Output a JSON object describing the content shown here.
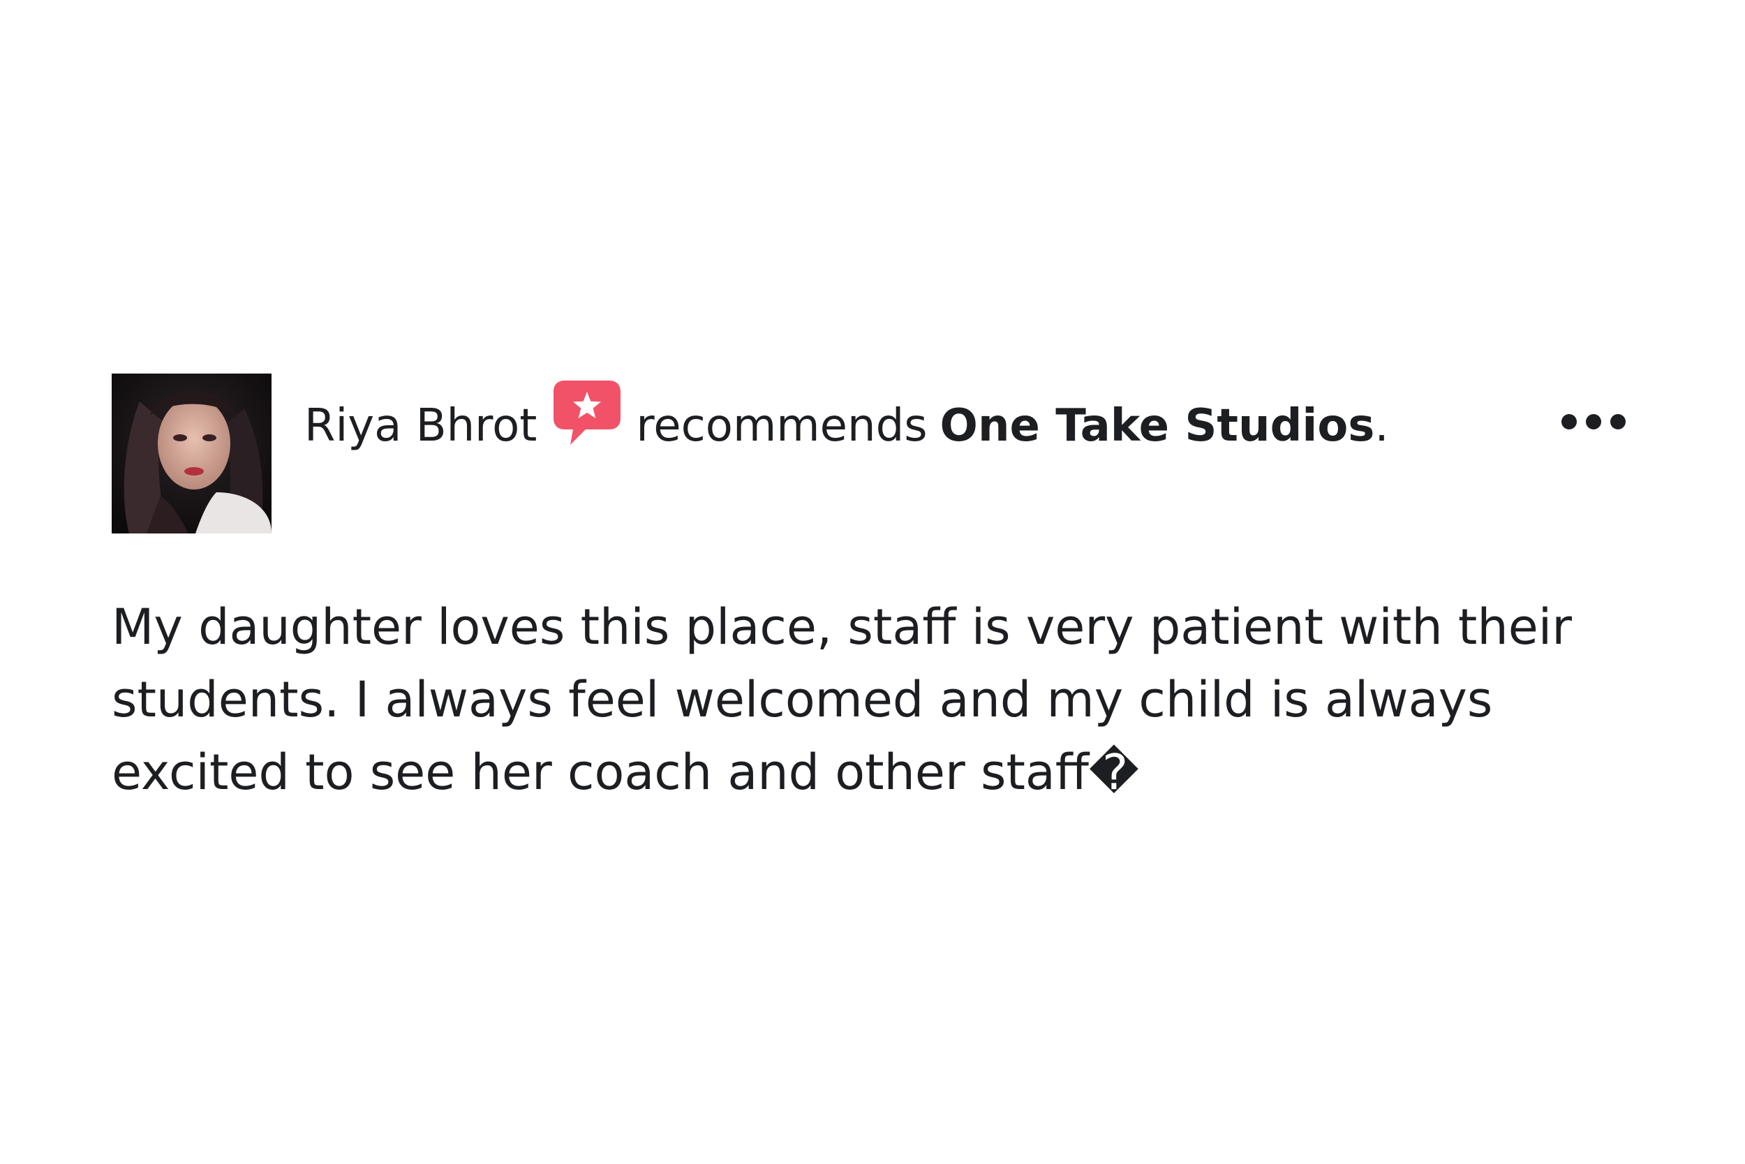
{
  "review": {
    "reviewer_name": "Riya Bhrot",
    "action_text": "recommends",
    "page_name": "One Take Studios",
    "period": ".",
    "text": "My daughter loves this place, staff is very patient with their students. I always feel welcomed and my child is always excited to see her coach and other staff�"
  },
  "icons": {
    "recommend": "speech-bubble-star-icon",
    "more": "more-options-icon"
  },
  "colors": {
    "text": "#1c1e21",
    "recommend_icon": "#f25268",
    "background": "#ffffff"
  }
}
